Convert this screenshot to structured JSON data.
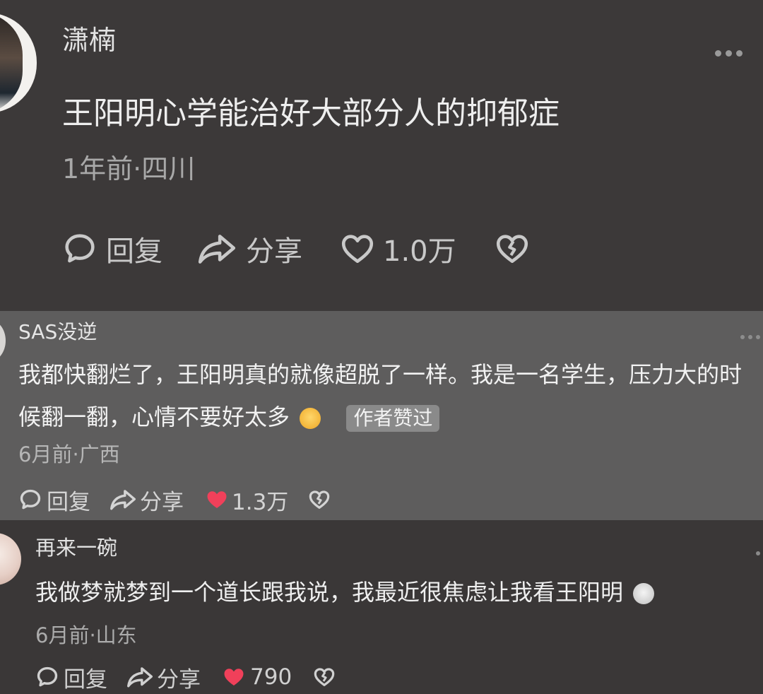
{
  "post": {
    "username": "潇楠",
    "content": "王阳明心学能治好大部分人的抑郁症",
    "meta": "1年前·四川",
    "reply_label": "回复",
    "share_label": "分享",
    "likes": "1.0万",
    "liked": false
  },
  "comments": [
    {
      "username": "SAS没逆",
      "content": "我都快翻烂了，王阳明真的就像超脱了一样。我是一名学生，压力大的时候翻一翻，心情不要好太多",
      "badge": "作者赞过",
      "meta": "6月前·广西",
      "reply_label": "回复",
      "share_label": "分享",
      "likes": "1.3万",
      "liked": true
    },
    {
      "username": "再来一碗",
      "content": "我做梦就梦到一个道长跟我说，我最近很焦虑让我看王阳明",
      "meta": "6月前·山东",
      "reply_label": "回复",
      "share_label": "分享",
      "likes": "790",
      "liked": true
    }
  ],
  "colors": {
    "like_active": "#f0405a",
    "icon": "#c9c9c9"
  }
}
